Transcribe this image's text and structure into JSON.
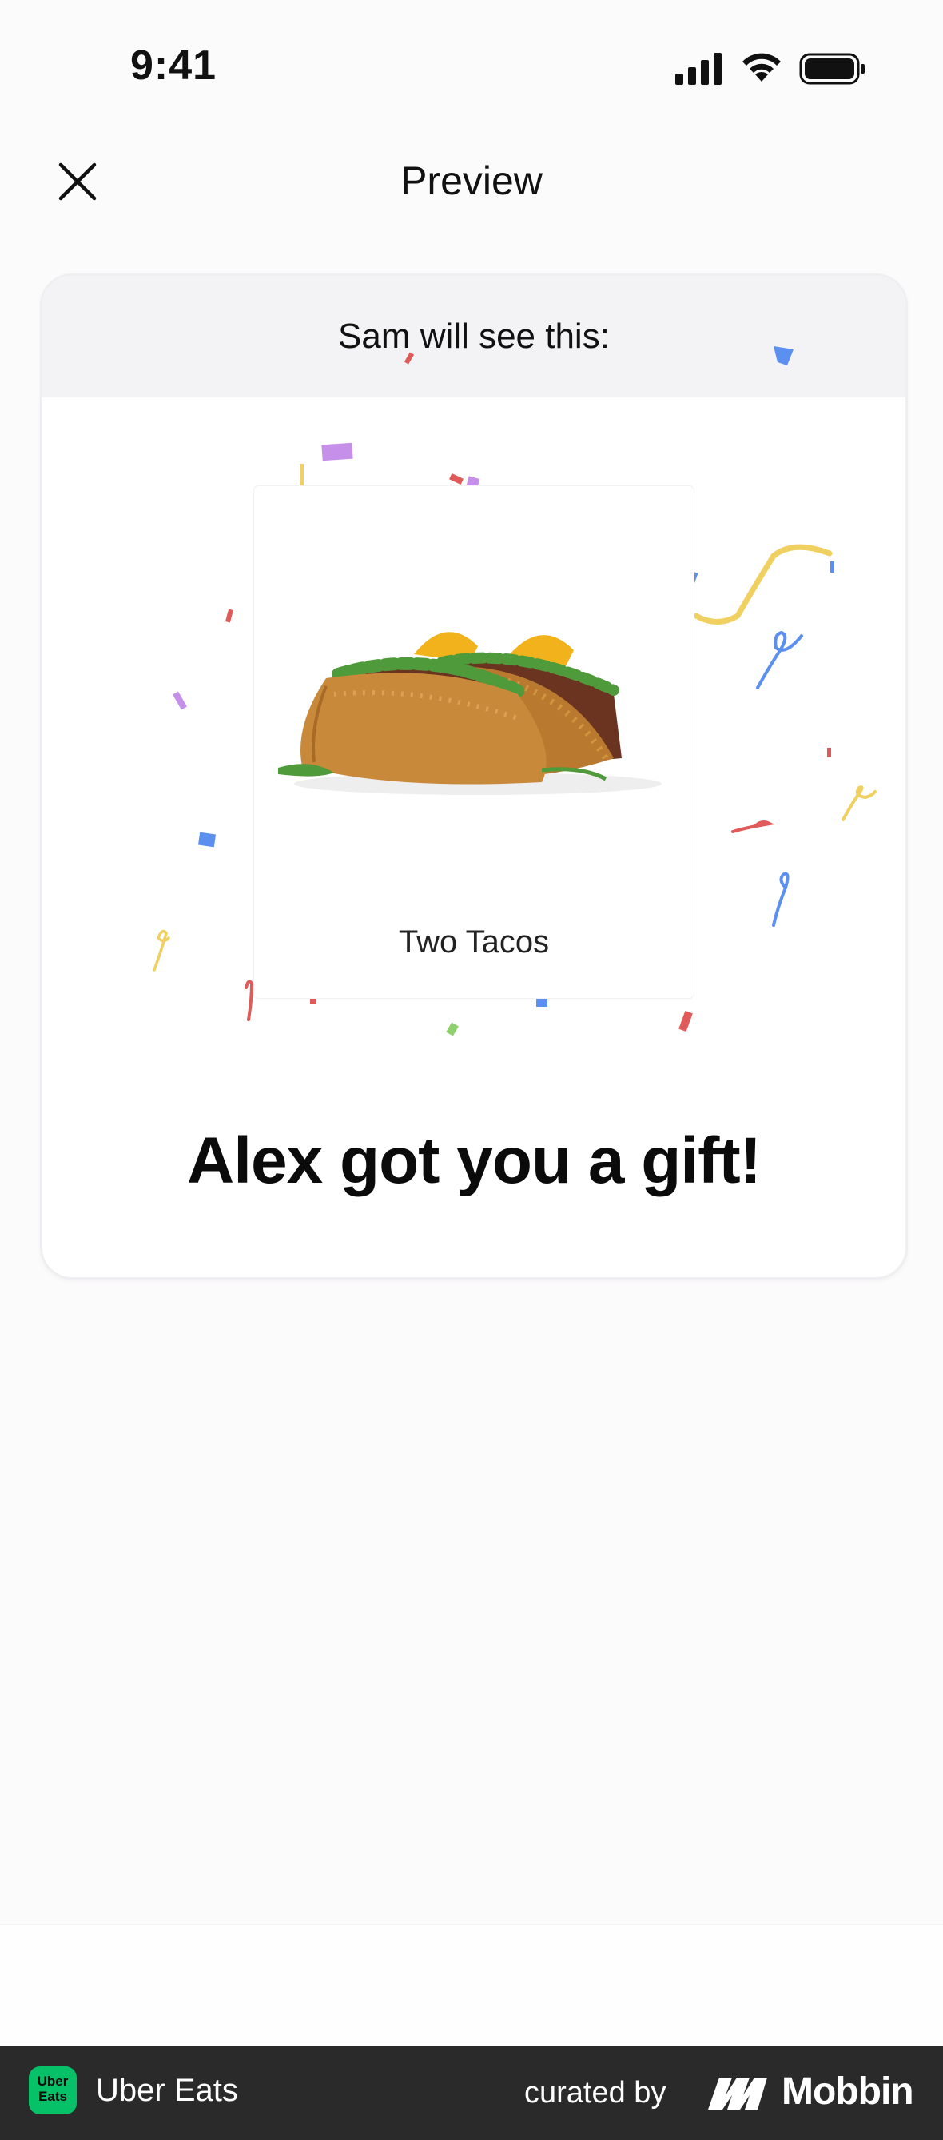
{
  "status_bar": {
    "time": "9:41"
  },
  "nav": {
    "title": "Preview",
    "close_icon": "close-icon"
  },
  "card": {
    "header": "Sam will see this:",
    "gift_name": "Two Tacos",
    "message": "Alex got you a gift!"
  },
  "footer": {
    "app_icon_text": "Uber\nEats",
    "app_name": "Uber Eats",
    "curated_by": "curated by",
    "brand": "Mobbin"
  },
  "colors": {
    "accent_green": "#06c167",
    "footer_bg": "#2a2a2a",
    "confetti": [
      "#e05a5a",
      "#c690ea",
      "#5b8ff0",
      "#f0d060"
    ]
  }
}
